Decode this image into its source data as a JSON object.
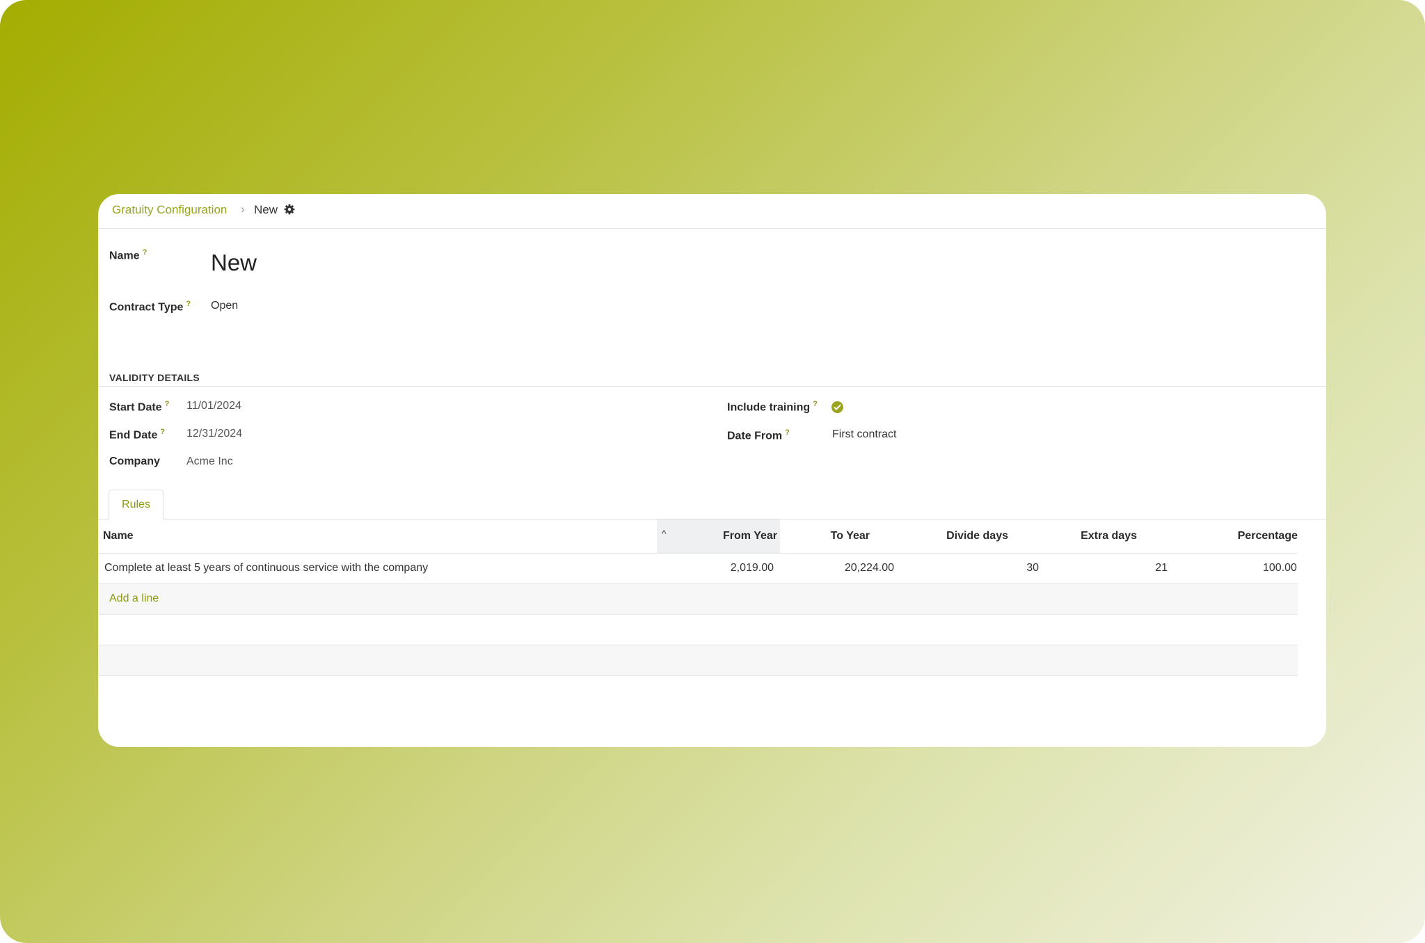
{
  "breadcrumb": {
    "parent": "Gratuity Configuration",
    "separator": "›",
    "current": "New"
  },
  "icons": {
    "settings": "gear-icon",
    "include_training": "check-circle-icon",
    "sort": "caret-up-icon"
  },
  "colors": {
    "accent": "#9aa41d",
    "background_gradient_start": "#a3ad00",
    "background_gradient_end": "#f2f2e4"
  },
  "form": {
    "name_label": "Name",
    "name_value": "New",
    "contract_type_label": "Contract Type",
    "contract_type_value": "Open",
    "help_mark": "?"
  },
  "validity": {
    "section_title": "VALIDITY DETAILS",
    "start_date_label": "Start Date",
    "start_date_value": "11/01/2024",
    "end_date_label": "End Date",
    "end_date_value": "12/31/2024",
    "company_label": "Company",
    "company_value": "Acme Inc",
    "include_training_label": "Include training",
    "include_training_value": true,
    "date_from_label": "Date From",
    "date_from_value": "First contract"
  },
  "tabs": [
    {
      "label": "Rules",
      "active": true
    }
  ],
  "rules_table": {
    "columns": [
      "Name",
      "From Year",
      "To Year",
      "Divide days",
      "Extra days",
      "Percentage"
    ],
    "sort_indicator": "^",
    "rows": [
      {
        "name": "Complete at least 5 years of continuous service with the company",
        "from_year": "2,019.00",
        "to_year": "20,224.00",
        "divide_days": "30",
        "extra_days": "21",
        "percentage": "100.00"
      }
    ],
    "add_line_label": "Add a line"
  }
}
